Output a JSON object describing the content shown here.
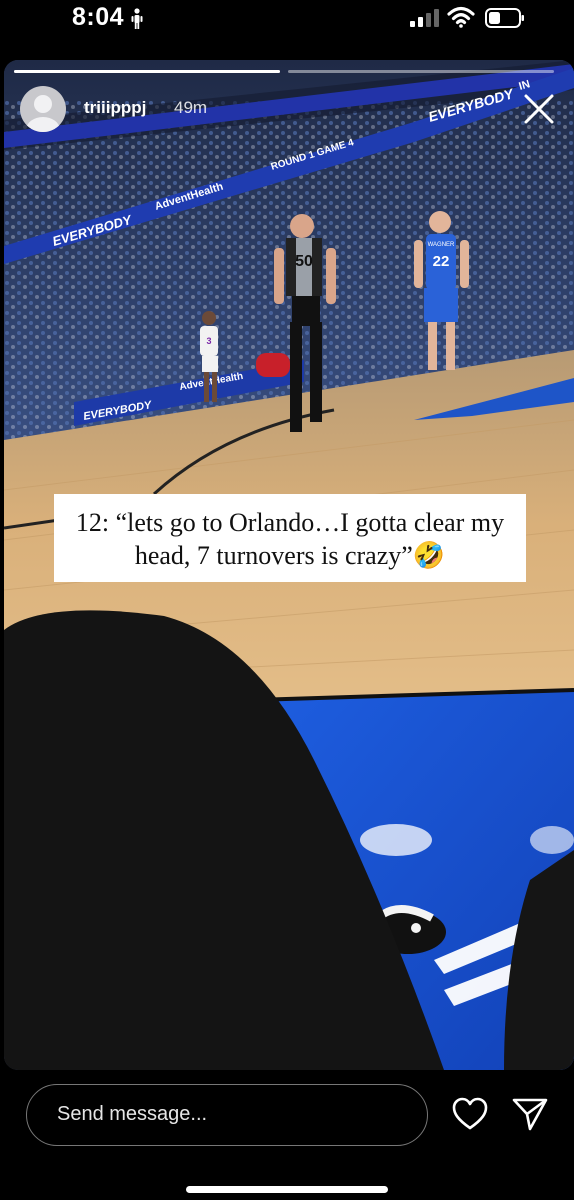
{
  "status": {
    "time": "8:04",
    "cellular_icon": "cellular-signal-icon",
    "wifi_icon": "wifi-icon",
    "battery_icon": "battery-icon",
    "activity_icon": "person-activity-icon"
  },
  "story": {
    "progress": [
      1.0,
      0.0
    ],
    "username": "triiipppj",
    "timestamp": "49m",
    "avatar_icon": "default-avatar-icon",
    "close_icon": "close-icon",
    "caption": "12: “lets go to Orlando…I gotta clear my head, 7 turnovers is crazy”🤣",
    "scene": {
      "ribbon_text_left": "EVERYBODY",
      "ribbon_text_right": "EVERYBODY",
      "ribbon_text_round": "ROUND 1 GAME 4",
      "ribbon_text_sponsor": "AdventHealth",
      "ribbon_text_in": "IN",
      "referee_number": "50",
      "player_number": "22",
      "player_name": "WAGNER",
      "player_left_number": "3"
    }
  },
  "bottom_bar": {
    "message_placeholder": "Send message...",
    "heart_icon": "heart-icon",
    "share_icon": "send-icon"
  },
  "colors": {
    "background": "#000000",
    "court_blue": "#1b56d6",
    "floor_wood": "#d9b07a",
    "caption_bg": "#ffffff"
  }
}
